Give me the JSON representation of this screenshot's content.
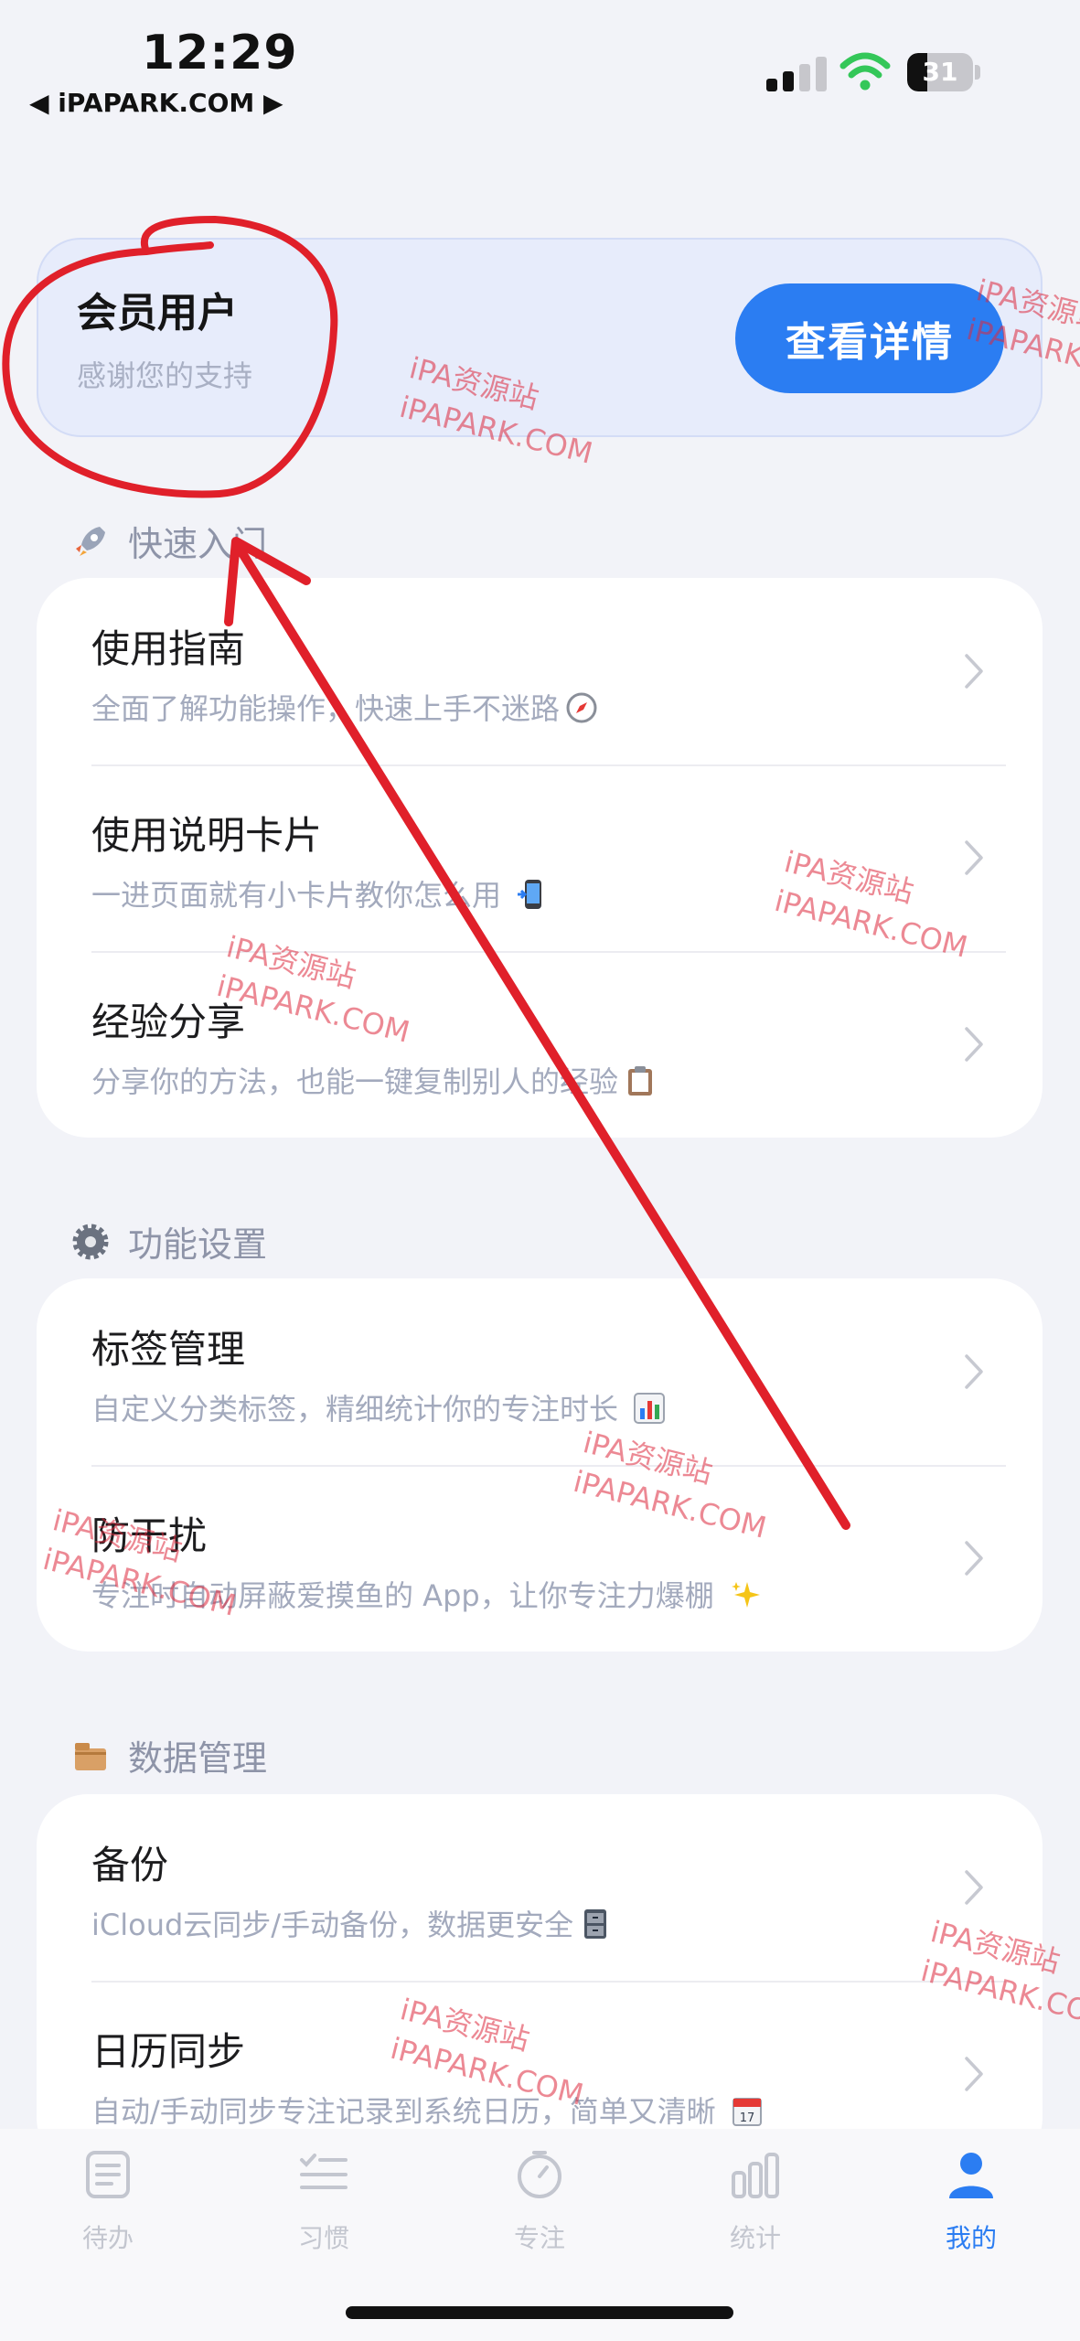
{
  "status_bar": {
    "time": "12:29",
    "back_app": "◀ iPAPARK.COM ▶",
    "battery_level": "31"
  },
  "member": {
    "title": "会员用户",
    "subtitle": "感谢您的支持",
    "button": "查看详情"
  },
  "sections": [
    {
      "label": "快速入门",
      "icon": "rocket-icon",
      "rows": [
        {
          "title": "使用指南",
          "subtitle": "全面了解功能操作，快速上手不迷路",
          "emoji": "compass-emoji"
        },
        {
          "title": "使用说明卡片",
          "subtitle": "一进页面就有小卡片教你怎么用 ",
          "emoji": "phone-emoji"
        },
        {
          "title": "经验分享",
          "subtitle": "分享你的方法，也能一键复制别人的经验",
          "emoji": "clipboard-emoji"
        }
      ]
    },
    {
      "label": "功能设置",
      "icon": "gear-icon",
      "rows": [
        {
          "title": "标签管理",
          "subtitle": "自定义分类标签，精细统计你的专注时长 ",
          "emoji": "bar-chart-emoji"
        },
        {
          "title": "防干扰",
          "subtitle": "专注时自动屏蔽爱摸鱼的 App，让你专注力爆棚 ",
          "emoji": "sparkles-emoji"
        }
      ]
    },
    {
      "label": "数据管理",
      "icon": "box-icon",
      "rows": [
        {
          "title": "备份",
          "subtitle": "iCloud云同步/手动备份，数据更安全",
          "emoji": "cabinet-emoji"
        },
        {
          "title": "日历同步",
          "subtitle": "自动/手动同步专注记录到系统日历，简单又清晰 ",
          "emoji": "calendar-emoji"
        }
      ]
    }
  ],
  "tabs": [
    {
      "label": "待办",
      "icon": "list-icon",
      "active": false
    },
    {
      "label": "习惯",
      "icon": "habit-icon",
      "active": false
    },
    {
      "label": "专注",
      "icon": "timer-icon",
      "active": false
    },
    {
      "label": "统计",
      "icon": "stats-icon",
      "active": false
    },
    {
      "label": "我的",
      "icon": "profile-icon",
      "active": true
    }
  ],
  "watermark": {
    "line1": "iPA资源站",
    "line2": "iPAPARK.COM"
  },
  "colors": {
    "accent": "#2b7df2",
    "background": "#f2f3f8",
    "annotation": "#e0202a"
  }
}
